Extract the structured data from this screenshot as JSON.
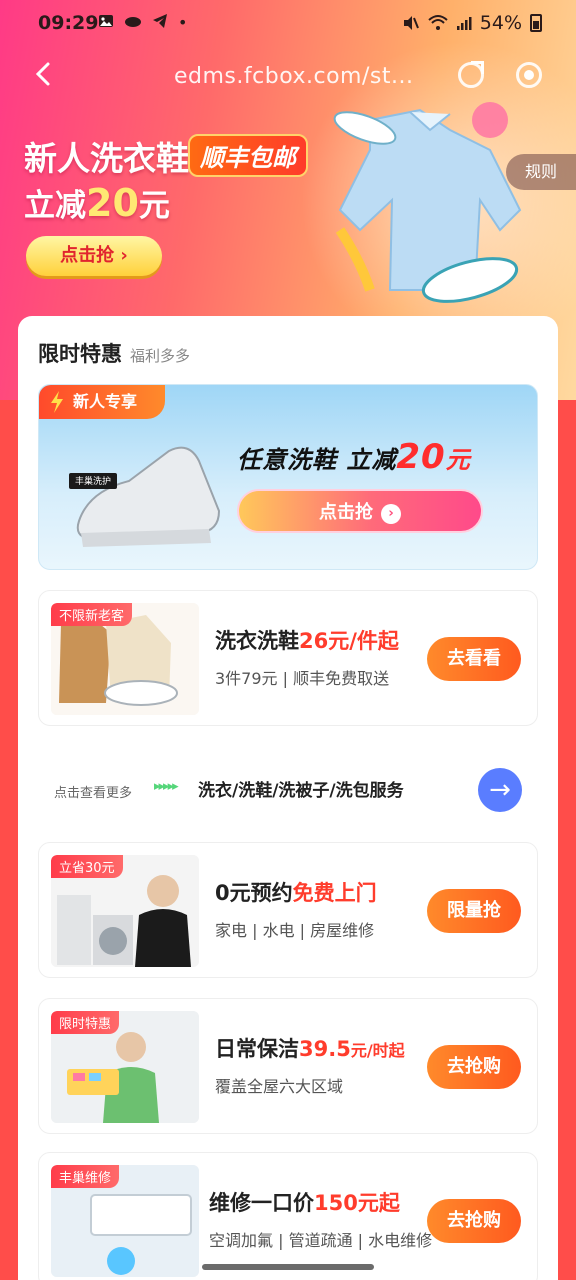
{
  "status_bar": {
    "time": "09:29",
    "dot": "•",
    "battery": "54%"
  },
  "nav": {
    "url": "edms.fcbox.com/st..."
  },
  "hero": {
    "title": "新人洗衣鞋",
    "tag": "顺丰包邮",
    "subtitle_prefix": "立减",
    "subtitle_amount": "20",
    "subtitle_suffix": "元",
    "cta": "点击抢 ›",
    "rules": "规则"
  },
  "section": {
    "title": "限时特惠",
    "subtitle": "福利多多"
  },
  "new_user_banner": {
    "tag": "新人专享",
    "headline_a": "任意洗鞋  立减",
    "headline_amount": "20",
    "headline_unit": "元",
    "cta": "点击抢",
    "shoe_label": "丰巢洗护"
  },
  "services": [
    {
      "badge": "不限新老客",
      "title_a": "洗衣洗鞋",
      "price": "26元/件起",
      "desc": "3件79元 | 顺丰免费取送",
      "button": "去看看"
    },
    {
      "badge": "立省30元",
      "title_a": "0元预约",
      "price": "免费上门",
      "desc": "家电 | 水电 | 房屋维修",
      "button": "限量抢"
    },
    {
      "badge": "限时特惠",
      "title_a": "日常保洁",
      "price": "39.5",
      "unit": "元/时起",
      "desc": "覆盖全屋六大区域",
      "button": "去抢购"
    },
    {
      "badge": "丰巢维修",
      "title_a": "维修一口价",
      "price": "150元起",
      "desc": "空调加氟 | 管道疏通 | 水电维修",
      "button": "去抢购"
    }
  ],
  "more": {
    "hint": "点击查看更多",
    "arrows": "▸▸▸▸▸",
    "services": "洗衣/洗鞋/洗被子/洗包服务"
  },
  "colors": {
    "accent_red": "#ff3c2c",
    "button_orange": "#ff6a1f",
    "go_blue": "#5a7dff"
  }
}
